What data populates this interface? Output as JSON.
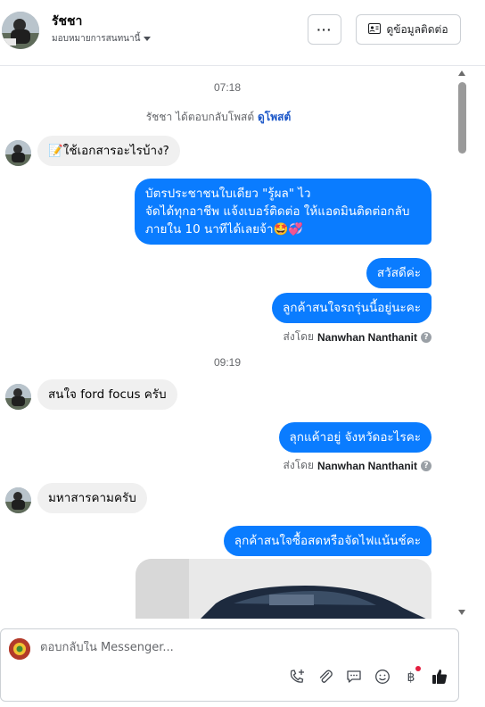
{
  "header": {
    "contact_name": "รัชชา",
    "assign_label": "มอบหมายการสนทนานี้",
    "more_label": "···",
    "contact_info_label": "ดูข้อมูลติดต่อ"
  },
  "chat": {
    "time_1": "07:18",
    "sys_text": "รัชชา ได้ตอบกลับโพสต์",
    "sys_link": "ดูโพสต์",
    "msg_in_1": "📝ใช้เอกสารอะไรบ้าง?",
    "msg_out_1": "บัตรประชาชนใบเดียว \"รู้ผล\" ไว\nจัดได้ทุกอาชีพ แจ้งเบอร์ติดต่อ ให้แอดมินติดต่อกลับ\nภายใน 10 นาทีได้เลยจ้า🤩💞",
    "msg_out_2": "สวัสดีค่ะ",
    "msg_out_3": "ลูกค้าสนใจรถรุ่นนี้อยู่นะคะ",
    "sent_by_prefix": "ส่งโดย",
    "sender_name": "Nanwhan Nanthanit",
    "time_2": "09:19",
    "msg_in_2": "สนใจ ford focus ครับ",
    "msg_out_4": "ลุกแค้าอยู่ จังหวัดอะไรคะ",
    "msg_in_3": "มหาสารคามครับ",
    "msg_out_5": "ลุกค้าสนใจซื้อสดหรือจัดไฟแน้นช์คะ"
  },
  "composer": {
    "placeholder": "ตอบกลับใน Messenger..."
  },
  "icons": [
    "phone-plus-icon",
    "paperclip-icon",
    "saved-reply-icon",
    "emoji-icon",
    "baht-payment-icon",
    "thumbs-up-icon"
  ],
  "colors": {
    "outgoing_bubble": "#0a7cff",
    "incoming_bubble": "#f0f0f0",
    "link": "#1a56c8"
  }
}
